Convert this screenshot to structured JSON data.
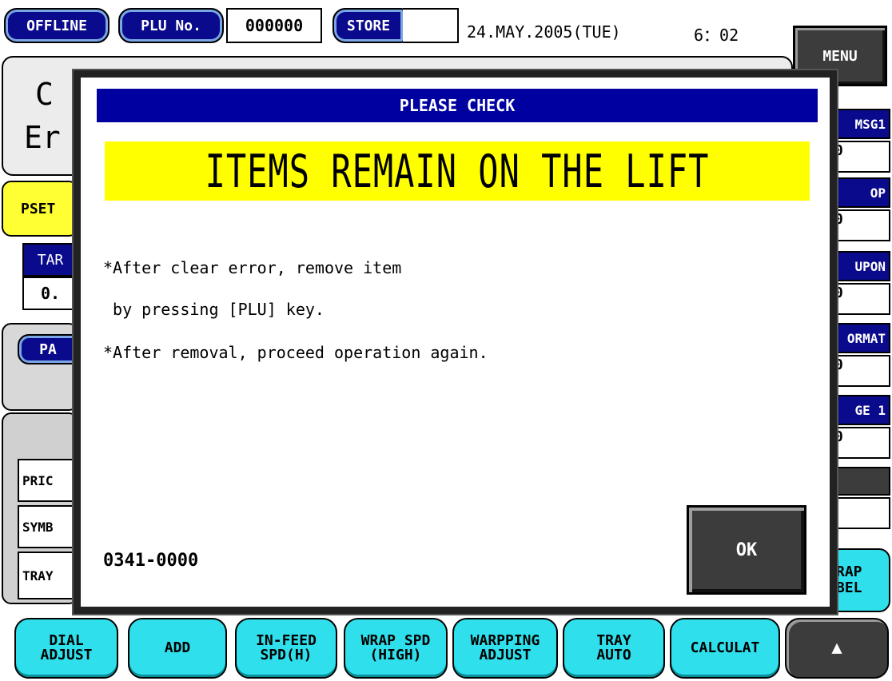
{
  "status_bar": {
    "mode_label": "OFFLINE",
    "plu_label": "PLU No.",
    "plu_value": "000000",
    "store_label": "STORE",
    "store_value": "",
    "date": "24.MAY.2005(TUE)",
    "time": "6：02",
    "menu_label": "MENU"
  },
  "background": {
    "main_partial_1": "C",
    "main_partial_2": "Er",
    "pset_label": "PSET",
    "tare_label": "TAR",
    "tare_value": "0.",
    "pa_label": "PA",
    "row_labels": [
      "PRIC",
      "SYMB",
      "TRAY"
    ],
    "right_panel": [
      {
        "label": "MSG1",
        "value": "0"
      },
      {
        "label": "OP",
        "value": "0"
      },
      {
        "label": "UPON",
        "value": "0"
      },
      {
        "label": "ORMAT",
        "value": "0"
      },
      {
        "label": "GE 1",
        "value": "0"
      }
    ],
    "wrap_label_partial_1": "RAP",
    "wrap_label_partial_2": "BEL"
  },
  "dialog": {
    "title": "PLEASE CHECK",
    "banner": "ITEMS REMAIN ON THE LIFT",
    "lines": [
      "*After clear error, remove item",
      " by pressing [PLU] key.",
      "*After removal, proceed operation again."
    ],
    "code": "0341-0000",
    "ok_label": "OK"
  },
  "function_keys": [
    "DIAL\nADJUST",
    "ADD",
    "IN-FEED\nSPD(H)",
    "WRAP SPD\n(HIGH)",
    "WARPPING\nADJUST",
    "TRAY\nAUTO",
    "CALCULAT",
    "▲"
  ],
  "colors": {
    "navy": "#0a0a8c",
    "dialog_title": "#0000a0",
    "banner_yellow": "#ffff00",
    "key_cyan": "#2fe0ec",
    "dark_button": "#3c3c3c"
  }
}
